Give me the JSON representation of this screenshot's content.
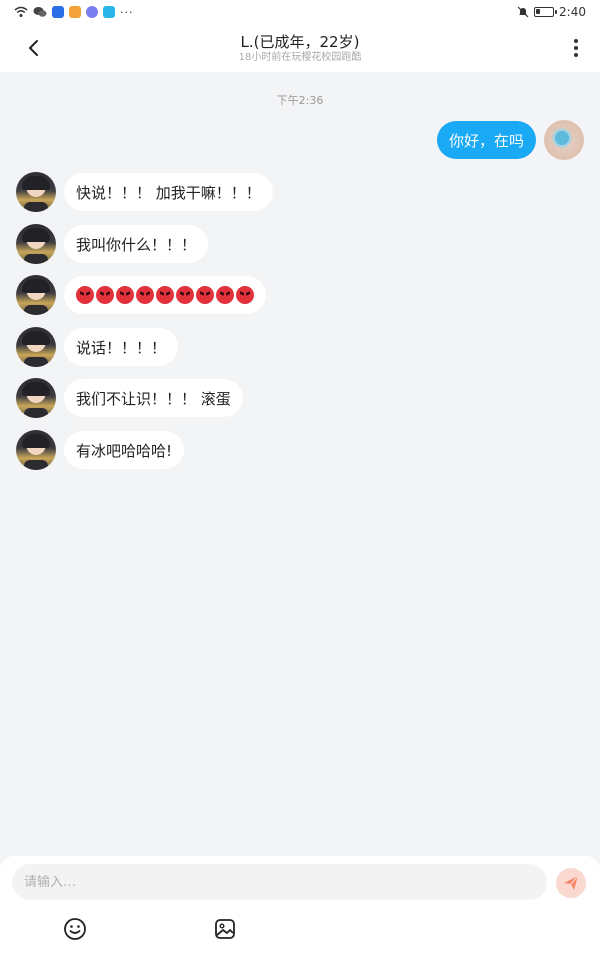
{
  "status_bar": {
    "time": "2:40",
    "battery_level": 0.25,
    "icons": [
      "wifi-icon",
      "wechat-icon",
      "app-blue-icon",
      "app-orange-icon",
      "app-purple-icon",
      "app-search-icon",
      "more-icon",
      "mute-icon",
      "battery-icon"
    ]
  },
  "header": {
    "title": "L.(已成年，22岁)",
    "subtitle": "18小时前在玩樱花校园跑酷"
  },
  "chat": {
    "timestamp": "下午2:36",
    "messages": [
      {
        "from": "me",
        "text": "你好，在吗"
      },
      {
        "from": "other",
        "text": "快说！！！ 加我干嘛！！！"
      },
      {
        "from": "other",
        "text": "我叫你什么！！！"
      },
      {
        "from": "other",
        "emoji": "angry-face",
        "count": 9
      },
      {
        "from": "other",
        "text": "说话！！！！"
      },
      {
        "from": "other",
        "text": "我们不让识！！！ 滚蛋"
      },
      {
        "from": "other",
        "text": "有冰吧哈哈哈!"
      }
    ]
  },
  "input": {
    "placeholder": "请输入…"
  },
  "colors": {
    "accent": "#19a9f5",
    "send_button_bg": "#fbd9d0",
    "send_icon": "#f6866a",
    "background": "#f3f4f6"
  }
}
